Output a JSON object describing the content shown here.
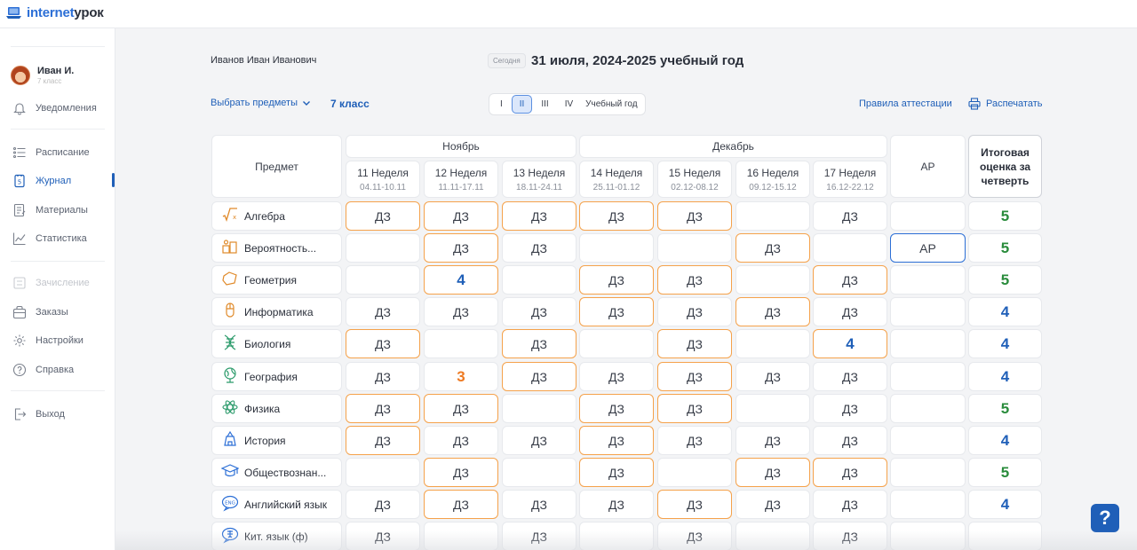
{
  "logo": {
    "part1": "internet",
    "part2": "урок"
  },
  "user": {
    "name": "Иван И.",
    "grade": "7 класс"
  },
  "nav": {
    "notifications": "Уведомления",
    "schedule": "Расписание",
    "journal": "Журнал",
    "materials": "Материалы",
    "statistics": "Статистика",
    "enrollment": "Зачисление",
    "orders": "Заказы",
    "settings": "Настройки",
    "help": "Справка",
    "logout": "Выход"
  },
  "header": {
    "student": "Иванов Иван Иванович",
    "today_label": "Сегодня",
    "date_title": "31 июля, 2024-2025 учебный год",
    "select_subjects": "Выбрать предметы",
    "klass": "7 класс",
    "periods": [
      "I",
      "II",
      "III",
      "IV",
      "Учебный год"
    ],
    "active_period": "II",
    "rules": "Правила аттестации",
    "print": "Распечатать"
  },
  "table": {
    "subject_header": "Предмет",
    "months": [
      "Ноябрь",
      "Декабрь"
    ],
    "weeks": [
      {
        "name": "11 Неделя",
        "dates": "04.11-10.11"
      },
      {
        "name": "12 Неделя",
        "dates": "11.11-17.11"
      },
      {
        "name": "13 Неделя",
        "dates": "18.11-24.11"
      },
      {
        "name": "14 Неделя",
        "dates": "25.11-01.12"
      },
      {
        "name": "15 Неделя",
        "dates": "02.12-08.12"
      },
      {
        "name": "16 Неделя",
        "dates": "09.12-15.12"
      },
      {
        "name": "17 Неделя",
        "dates": "16.12-22.12"
      }
    ],
    "ar_header": "АР",
    "final_header": "Итоговая оценка за четверть",
    "rows": [
      {
        "subject": "Алгебра",
        "icon": "algebra-icon",
        "cells": [
          [
            "ДЗ",
            "hw"
          ],
          [
            "ДЗ",
            "hw"
          ],
          [
            "ДЗ",
            "hw"
          ],
          [
            "ДЗ",
            "hw"
          ],
          [
            "ДЗ",
            "hw"
          ],
          [
            "",
            ""
          ],
          [
            "ДЗ",
            ""
          ]
        ],
        "ar": [
          "",
          ""
        ],
        "final": "5"
      },
      {
        "subject": "Вероятность...",
        "icon": "probability-icon",
        "cells": [
          [
            "",
            ""
          ],
          [
            "ДЗ",
            "hw"
          ],
          [
            "ДЗ",
            ""
          ],
          [
            "",
            ""
          ],
          [
            "",
            ""
          ],
          [
            "ДЗ",
            "hw"
          ],
          [
            "",
            ""
          ]
        ],
        "ar": [
          "АР",
          "ar"
        ],
        "final": "5"
      },
      {
        "subject": "Геометрия",
        "icon": "geometry-icon",
        "cells": [
          [
            "",
            ""
          ],
          [
            "4",
            "hw"
          ],
          [
            "",
            ""
          ],
          [
            "ДЗ",
            "hw"
          ],
          [
            "ДЗ",
            "hw"
          ],
          [
            "",
            ""
          ],
          [
            "ДЗ",
            "hw"
          ]
        ],
        "ar": [
          "",
          ""
        ],
        "final": "5"
      },
      {
        "subject": "Информатика",
        "icon": "informatics-icon",
        "cells": [
          [
            "ДЗ",
            ""
          ],
          [
            "ДЗ",
            ""
          ],
          [
            "ДЗ",
            ""
          ],
          [
            "ДЗ",
            "hw"
          ],
          [
            "ДЗ",
            ""
          ],
          [
            "ДЗ",
            "hw"
          ],
          [
            "ДЗ",
            ""
          ]
        ],
        "ar": [
          "",
          ""
        ],
        "final": "4"
      },
      {
        "subject": "Биология",
        "icon": "biology-icon",
        "cells": [
          [
            "ДЗ",
            "hw"
          ],
          [
            "",
            ""
          ],
          [
            "ДЗ",
            "hw"
          ],
          [
            "",
            ""
          ],
          [
            "ДЗ",
            "hw"
          ],
          [
            "",
            ""
          ],
          [
            "4",
            "hw"
          ]
        ],
        "ar": [
          "",
          ""
        ],
        "final": "4"
      },
      {
        "subject": "География",
        "icon": "geography-icon",
        "cells": [
          [
            "ДЗ",
            ""
          ],
          [
            "3",
            ""
          ],
          [
            "ДЗ",
            "hw"
          ],
          [
            "ДЗ",
            ""
          ],
          [
            "ДЗ",
            "hw"
          ],
          [
            "ДЗ",
            ""
          ],
          [
            "ДЗ",
            ""
          ]
        ],
        "ar": [
          "",
          ""
        ],
        "final": "4"
      },
      {
        "subject": "Физика",
        "icon": "physics-icon",
        "cells": [
          [
            "ДЗ",
            "hw"
          ],
          [
            "ДЗ",
            "hw"
          ],
          [
            "",
            ""
          ],
          [
            "ДЗ",
            "hw"
          ],
          [
            "ДЗ",
            "hw"
          ],
          [
            "",
            ""
          ],
          [
            "ДЗ",
            ""
          ]
        ],
        "ar": [
          "",
          ""
        ],
        "final": "5"
      },
      {
        "subject": "История",
        "icon": "history-icon",
        "cells": [
          [
            "ДЗ",
            "hw"
          ],
          [
            "ДЗ",
            ""
          ],
          [
            "ДЗ",
            ""
          ],
          [
            "ДЗ",
            "hw"
          ],
          [
            "ДЗ",
            ""
          ],
          [
            "ДЗ",
            ""
          ],
          [
            "ДЗ",
            ""
          ]
        ],
        "ar": [
          "",
          ""
        ],
        "final": "4"
      },
      {
        "subject": "Обществознан...",
        "icon": "social-studies-icon",
        "cells": [
          [
            "",
            ""
          ],
          [
            "ДЗ",
            "hw"
          ],
          [
            "",
            ""
          ],
          [
            "ДЗ",
            "hw"
          ],
          [
            "",
            ""
          ],
          [
            "ДЗ",
            "hw"
          ],
          [
            "ДЗ",
            "hw"
          ]
        ],
        "ar": [
          "",
          ""
        ],
        "final": "5"
      },
      {
        "subject": "Английский язык",
        "icon": "english-icon",
        "cells": [
          [
            "ДЗ",
            ""
          ],
          [
            "ДЗ",
            "hw"
          ],
          [
            "ДЗ",
            ""
          ],
          [
            "ДЗ",
            ""
          ],
          [
            "ДЗ",
            "hw"
          ],
          [
            "ДЗ",
            ""
          ],
          [
            "ДЗ",
            ""
          ]
        ],
        "ar": [
          "",
          ""
        ],
        "final": "4"
      },
      {
        "subject": "Кит. язык (ф)",
        "icon": "chinese-icon",
        "cells": [
          [
            "ДЗ",
            ""
          ],
          [
            "",
            ""
          ],
          [
            "ДЗ",
            ""
          ],
          [
            "",
            ""
          ],
          [
            "ДЗ",
            ""
          ],
          [
            "",
            ""
          ],
          [
            "ДЗ",
            ""
          ]
        ],
        "ar": [
          "",
          ""
        ],
        "final": ""
      }
    ]
  },
  "help_button": "?",
  "colors": {
    "accent": "#1f5fb8",
    "homework_border": "#f5a24b",
    "grade5": "#2a8c3c",
    "grade4": "#1f5fb8",
    "grade3": "#ee7a22"
  }
}
